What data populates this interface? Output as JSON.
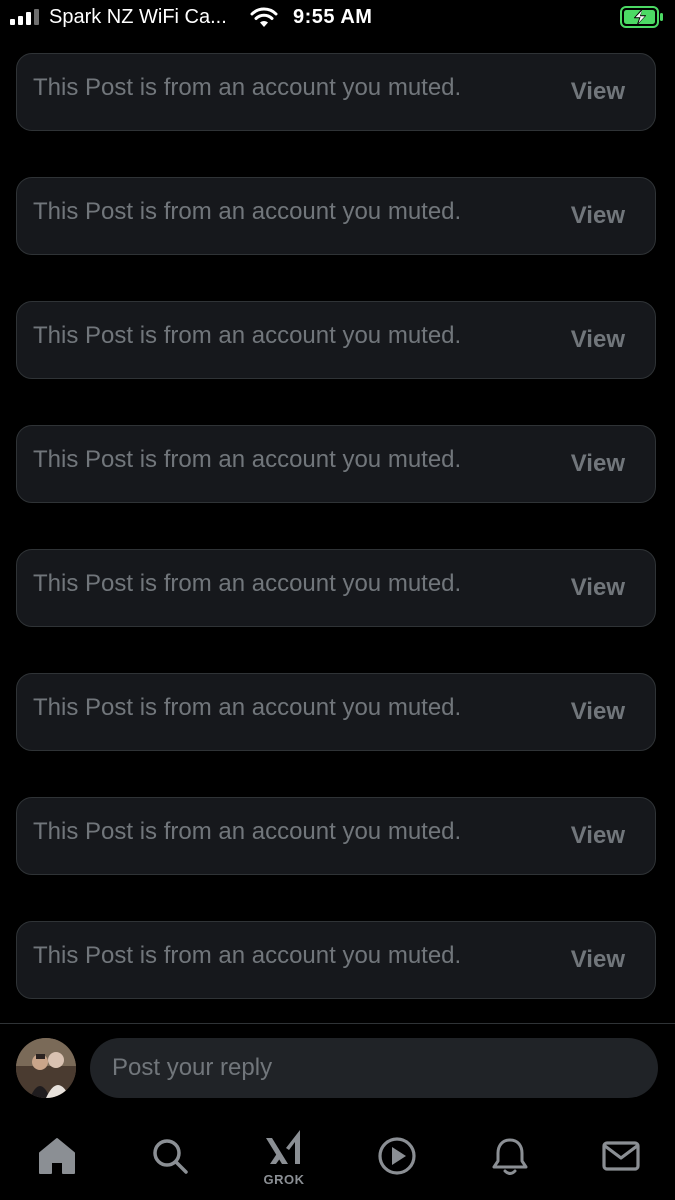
{
  "status_bar": {
    "carrier": "Spark NZ WiFi Ca...",
    "time": "9:55 AM"
  },
  "muted_posts": [
    {
      "text": "This Post is from an account you muted.",
      "action": "View"
    },
    {
      "text": "This Post is from an account you muted.",
      "action": "View"
    },
    {
      "text": "This Post is from an account you muted.",
      "action": "View"
    },
    {
      "text": "This Post is from an account you muted.",
      "action": "View"
    },
    {
      "text": "This Post is from an account you muted.",
      "action": "View"
    },
    {
      "text": "This Post is from an account you muted.",
      "action": "View"
    },
    {
      "text": "This Post is from an account you muted.",
      "action": "View"
    },
    {
      "text": "This Post is from an account you muted.",
      "action": "View"
    }
  ],
  "reply": {
    "placeholder": "Post your reply"
  },
  "bottom_nav": {
    "items": [
      {
        "icon": "home-icon",
        "active": true
      },
      {
        "icon": "search-icon",
        "active": false
      },
      {
        "icon": "grok-icon",
        "active": false
      },
      {
        "icon": "video-icon",
        "active": false
      },
      {
        "icon": "notifications-icon",
        "active": false
      },
      {
        "icon": "messages-icon",
        "active": false
      }
    ],
    "grok_label": "GROK"
  },
  "colors": {
    "background": "#000000",
    "card": "#16181c",
    "card_border": "#2f3336",
    "muted_text": "#71767b",
    "input_bg": "#202327",
    "battery_green": "#4cd964"
  }
}
